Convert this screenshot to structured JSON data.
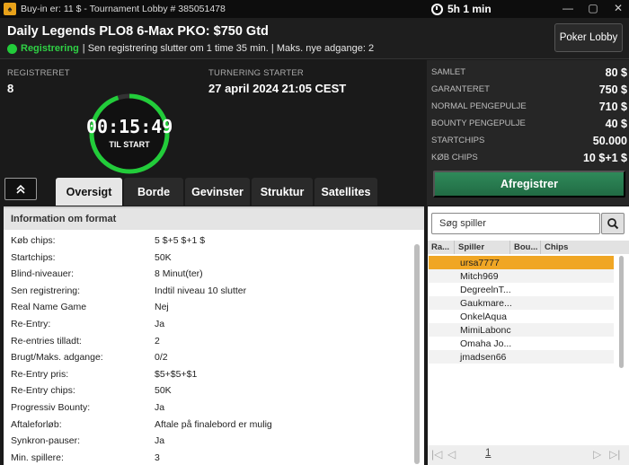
{
  "window": {
    "title": "Buy-in er: 11 $ - Tournament Lobby # 385051478",
    "timer": "5h 1 min",
    "minimize": "—",
    "maximize": "▢",
    "close": "✕"
  },
  "header": {
    "tournament_name": "Daily Legends PLO8 6-Max PKO: $750 Gtd",
    "status": "Registrering",
    "status_details": "| Sen registrering slutter om 1 time   35 min.  | Maks. nye adgange: 2",
    "lobby_button": "Poker Lobby"
  },
  "summary": {
    "registered_label": "REGISTRERET",
    "registered_value": "8",
    "start_label": "TURNERING STARTER",
    "start_value": "27 april 2024  21:05 CEST",
    "countdown": "00:15:49",
    "countdown_label": "TIL START",
    "countdown_progress": 0.95
  },
  "prize_info": [
    {
      "label": "SAMLET",
      "value": "80 $"
    },
    {
      "label": "GARANTERET",
      "value": "750 $"
    },
    {
      "label": "NORMAL PENGEPULJE",
      "value": "710 $"
    },
    {
      "label": "BOUNTY PENGEPULJE",
      "value": "40 $"
    },
    {
      "label": "STARTCHIPS",
      "value": "50.000"
    },
    {
      "label": "KØB CHIPS",
      "value": "10 $+1 $"
    }
  ],
  "unregister_button": "Afregistrer",
  "tabs": [
    {
      "label": "Oversigt",
      "active": true
    },
    {
      "label": "Borde",
      "active": false
    },
    {
      "label": "Gevinster",
      "active": false
    },
    {
      "label": "Struktur",
      "active": false
    },
    {
      "label": "Satellites",
      "active": false
    }
  ],
  "format": {
    "heading": "Information om format",
    "rows": [
      {
        "key": "Køb chips:",
        "value": "5 $+5 $+1 $"
      },
      {
        "key": "Startchips:",
        "value": "50K"
      },
      {
        "key": "Blind-niveauer:",
        "value": "8 Minut(ter)"
      },
      {
        "key": "Sen registrering:",
        "value": "Indtil niveau 10 slutter"
      },
      {
        "key": "Real Name Game",
        "value": "Nej"
      },
      {
        "key": "Re-Entry:",
        "value": "Ja"
      },
      {
        "key": "Re-entries tilladt:",
        "value": "2"
      },
      {
        "key": "Brugt/Maks. adgange:",
        "value": "0/2"
      },
      {
        "key": "Re-Entry pris:",
        "value": "$5+$5+$1"
      },
      {
        "key": "Re-Entry chips:",
        "value": "50K"
      },
      {
        "key": "Progressiv Bounty:",
        "value": "Ja"
      },
      {
        "key": "Aftaleforløb:",
        "value": "Aftale på finalebord er mulig"
      },
      {
        "key": "Synkron-pauser:",
        "value": "Ja"
      },
      {
        "key": "Min. spillere:",
        "value": "3"
      }
    ]
  },
  "players": {
    "search_placeholder": "Søg spiller",
    "columns": [
      "Ra...",
      "Spiller",
      "Bou...",
      "Chips"
    ],
    "list": [
      "ursa7777",
      "Mitch969",
      "DegreelnT...",
      "Gaukmare...",
      "OnkelAqua",
      "MimiLabonc",
      "Omaha Jo...",
      "jmadsen66"
    ],
    "selected_index": 0,
    "page": "1",
    "pager_first": "|◁",
    "pager_prev": "◁",
    "pager_next": "▷",
    "pager_last": "▷|"
  },
  "colors": {
    "accent_green": "#22cc3a",
    "button_green": "#2f8a5a",
    "selected_row": "#f0a624"
  }
}
